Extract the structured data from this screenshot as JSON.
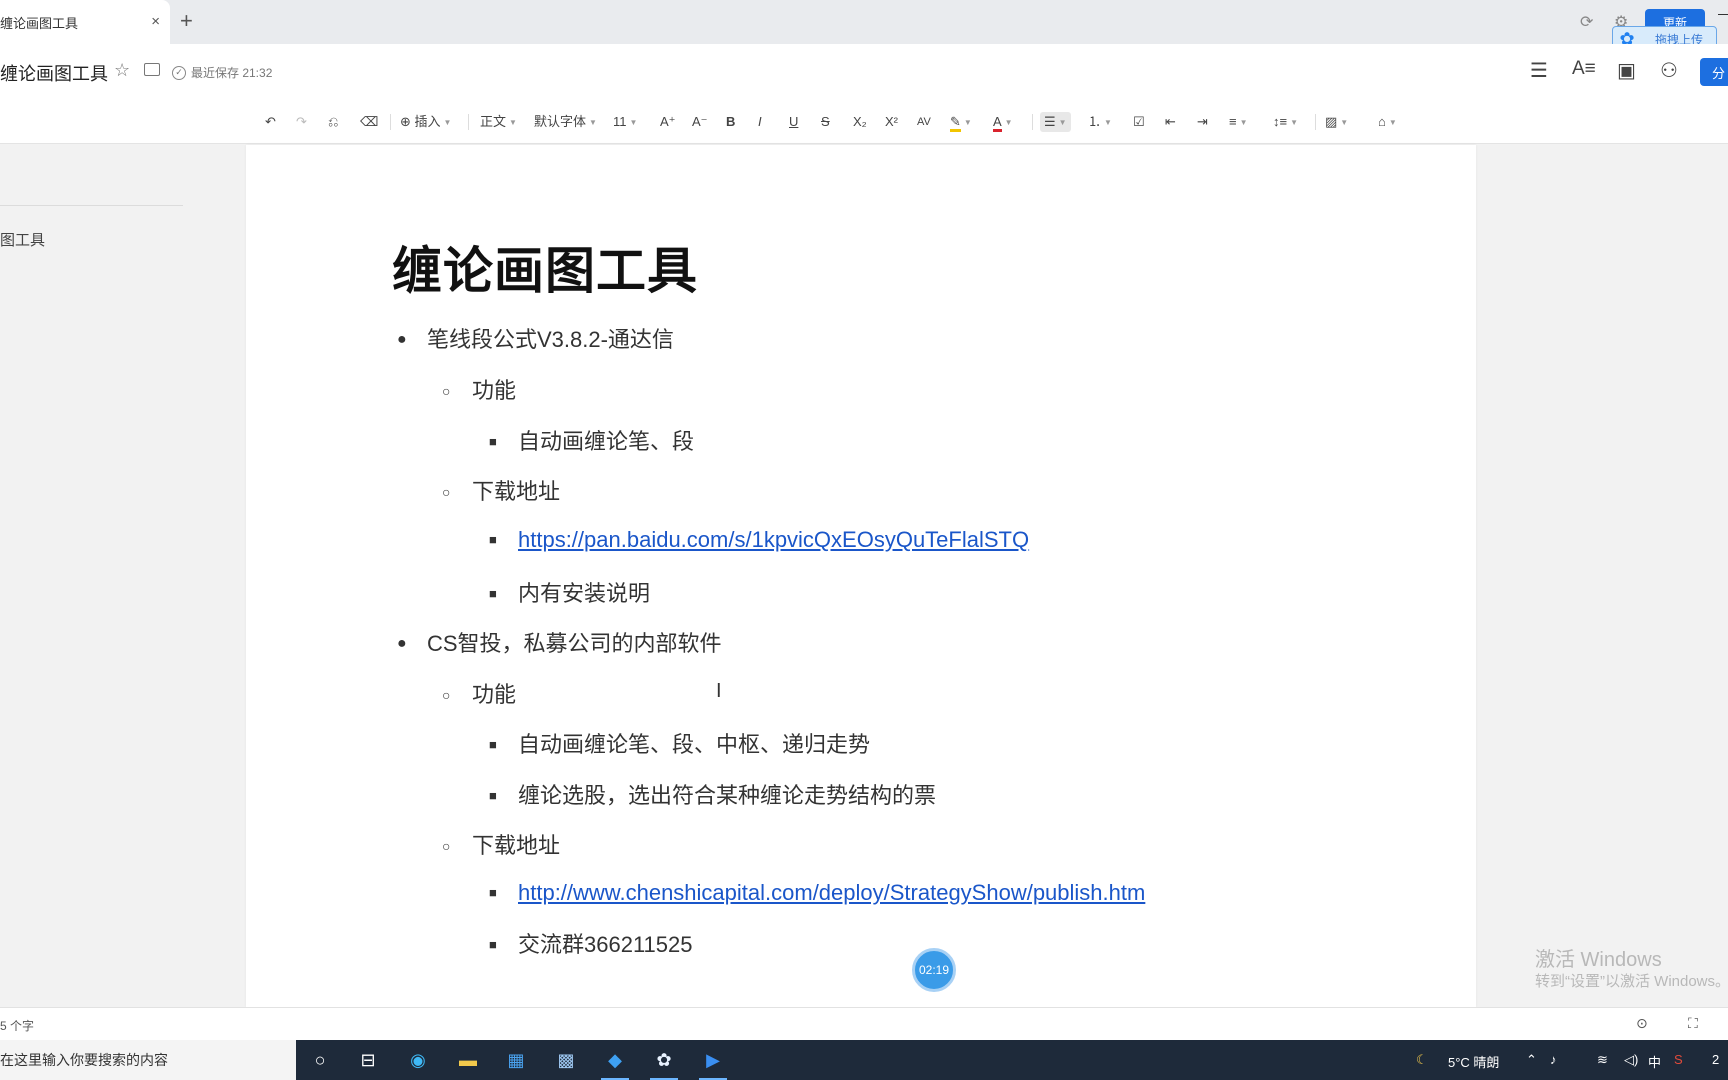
{
  "tab": {
    "title": "缠论画图工具",
    "close": "×",
    "add": "+"
  },
  "topbar": {
    "update_label": "更新",
    "upload_label": "拖拽上传"
  },
  "titlebar": {
    "doc_title": "缠论画图工具",
    "save_status": "最近保存 21:32",
    "share_label": "分"
  },
  "toolbar": {
    "insert": "插入",
    "style": "正文",
    "font": "默认字体",
    "size": "11",
    "bold": "B",
    "italic": "I",
    "underline": "U",
    "strike": "S",
    "subscript": "X₂",
    "superscript": "X²",
    "font_color": "A"
  },
  "sidebar": {
    "item": "图工具"
  },
  "document": {
    "heading": "缠论画图工具",
    "items": [
      {
        "level": 1,
        "text": "笔线段公式V3.8.2-通达信"
      },
      {
        "level": 2,
        "text": "功能"
      },
      {
        "level": 3,
        "text": "自动画缠论笔、段"
      },
      {
        "level": 2,
        "text": "下载地址"
      },
      {
        "level": 3,
        "text": "https://pan.baidu.com/s/1kpvicQxEOsyQuTeFlalSTQ",
        "link": true
      },
      {
        "level": 3,
        "text": "内有安装说明"
      },
      {
        "level": 1,
        "text": "CS智投，私募公司的内部软件"
      },
      {
        "level": 2,
        "text": "功能"
      },
      {
        "level": 3,
        "text": "自动画缠论笔、段、中枢、递归走势"
      },
      {
        "level": 3,
        "text": "缠论选股，选出符合某种缠论走势结构的票"
      },
      {
        "level": 2,
        "text": "下载地址"
      },
      {
        "level": 3,
        "text": "http://www.chenshicapital.com/deploy/StrategyShow/publish.htm",
        "link": true
      },
      {
        "level": 3,
        "text": "交流群366211525"
      }
    ]
  },
  "timer": "02:19",
  "watermark": {
    "line1": "激活 Windows",
    "line2": "转到“设置”以激活 Windows。"
  },
  "statusbar": {
    "word_count": "5 个字"
  },
  "taskbar": {
    "search_placeholder": "在这里输入你要搜索的内容",
    "weather": "5°C  晴朗",
    "ime": "中",
    "clock": "2"
  },
  "colors": {
    "accent": "#1d6fe0",
    "link": "#1a56c9",
    "taskbar": "#1e2a3a"
  }
}
